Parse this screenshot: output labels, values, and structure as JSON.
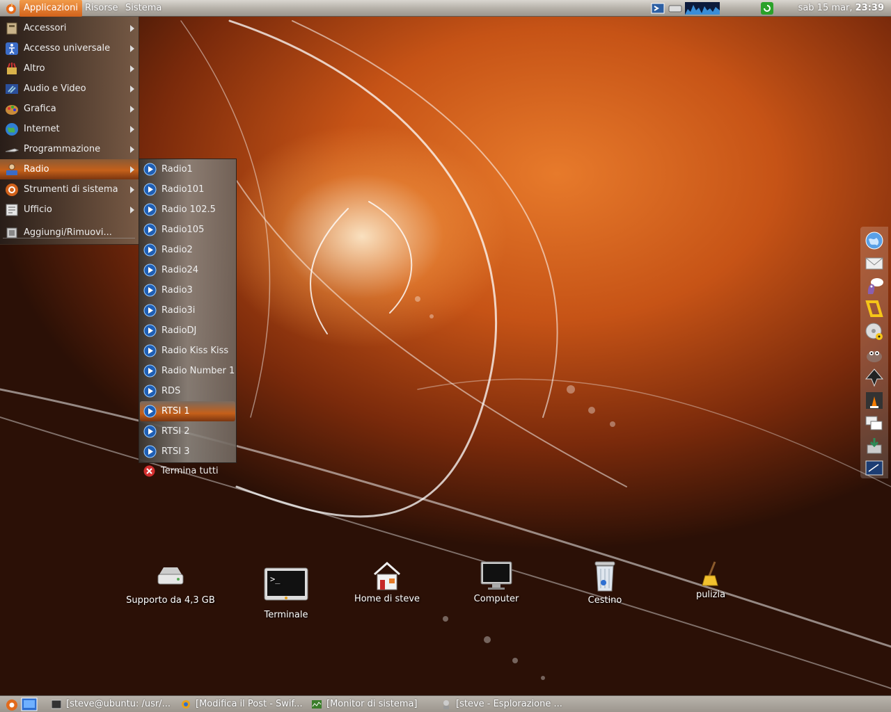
{
  "top_panel": {
    "menus": [
      "Applicazioni",
      "Risorse",
      "Sistema"
    ],
    "clock_day": "sab 15 mar,",
    "clock_time": "23:39"
  },
  "app_menu": {
    "items": [
      {
        "label": "Accessori",
        "icon": "accessories-icon"
      },
      {
        "label": "Accesso universale",
        "icon": "accessibility-icon"
      },
      {
        "label": "Altro",
        "icon": "other-icon"
      },
      {
        "label": "Audio e Video",
        "icon": "audio-video-icon"
      },
      {
        "label": "Grafica",
        "icon": "graphics-icon"
      },
      {
        "label": "Internet",
        "icon": "internet-globe-icon"
      },
      {
        "label": "Programmazione",
        "icon": "programming-icon"
      },
      {
        "label": "Radio",
        "icon": "radio-icon"
      },
      {
        "label": "Strumenti di sistema",
        "icon": "system-tools-icon"
      },
      {
        "label": "Ufficio",
        "icon": "office-icon"
      }
    ],
    "add_remove": "Aggiungi/Rimuovi..."
  },
  "radio_menu": {
    "items": [
      "Radio1",
      "Radio101",
      "Radio 102.5",
      "Radio105",
      "Radio2",
      "Radio24",
      "Radio3",
      "Radio3i",
      "RadioDJ",
      "Radio Kiss Kiss",
      "Radio Number 1",
      "RDS",
      "RTSI 1",
      "RTSI 2",
      "RTSI 3"
    ],
    "stop_all": "Termina tutti"
  },
  "desktop_icons": {
    "drive": "Supporto da 4,3 GB",
    "terminal": "Terminale",
    "home": "Home di steve",
    "computer": "Computer",
    "trash": "Cestino",
    "cleanup": "pulizia"
  },
  "taskbar": {
    "tasks": [
      "[steve@ubuntu: /usr/...",
      "[Modifica il Post - Swif...",
      "[Monitor di sistema]",
      "[steve - Esplorazione ..."
    ]
  },
  "colors": {
    "accent_orange": "#d2621b",
    "panel_grey": "#b3aea6"
  }
}
